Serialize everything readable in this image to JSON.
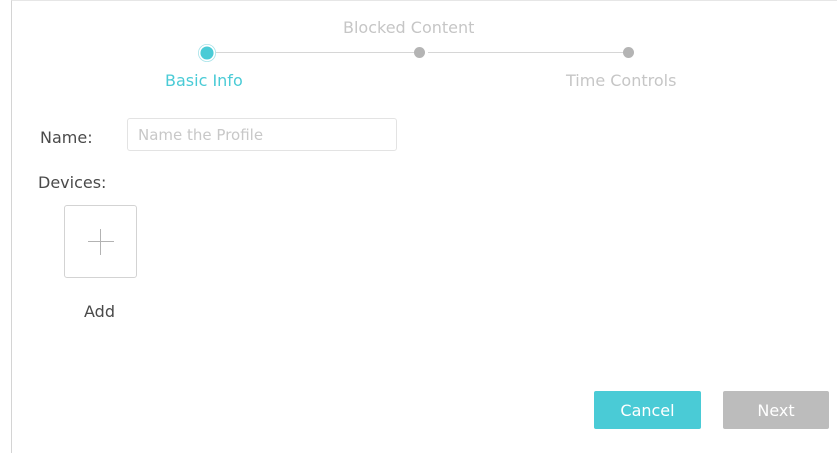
{
  "stepper": {
    "steps": [
      {
        "label": "Basic Info",
        "state": "active"
      },
      {
        "label": "Blocked Content",
        "state": "pending"
      },
      {
        "label": "Time Controls",
        "state": "pending"
      }
    ]
  },
  "form": {
    "name_label": "Name:",
    "name_placeholder": "Name the Profile",
    "name_value": "",
    "devices_label": "Devices:",
    "add_label": "Add",
    "add_icon": "plus-icon"
  },
  "actions": {
    "cancel_label": "Cancel",
    "next_label": "Next"
  },
  "colors": {
    "accent": "#4acbd6",
    "inactive": "#b4b4b4",
    "disabled_button": "#bcbcbc"
  }
}
